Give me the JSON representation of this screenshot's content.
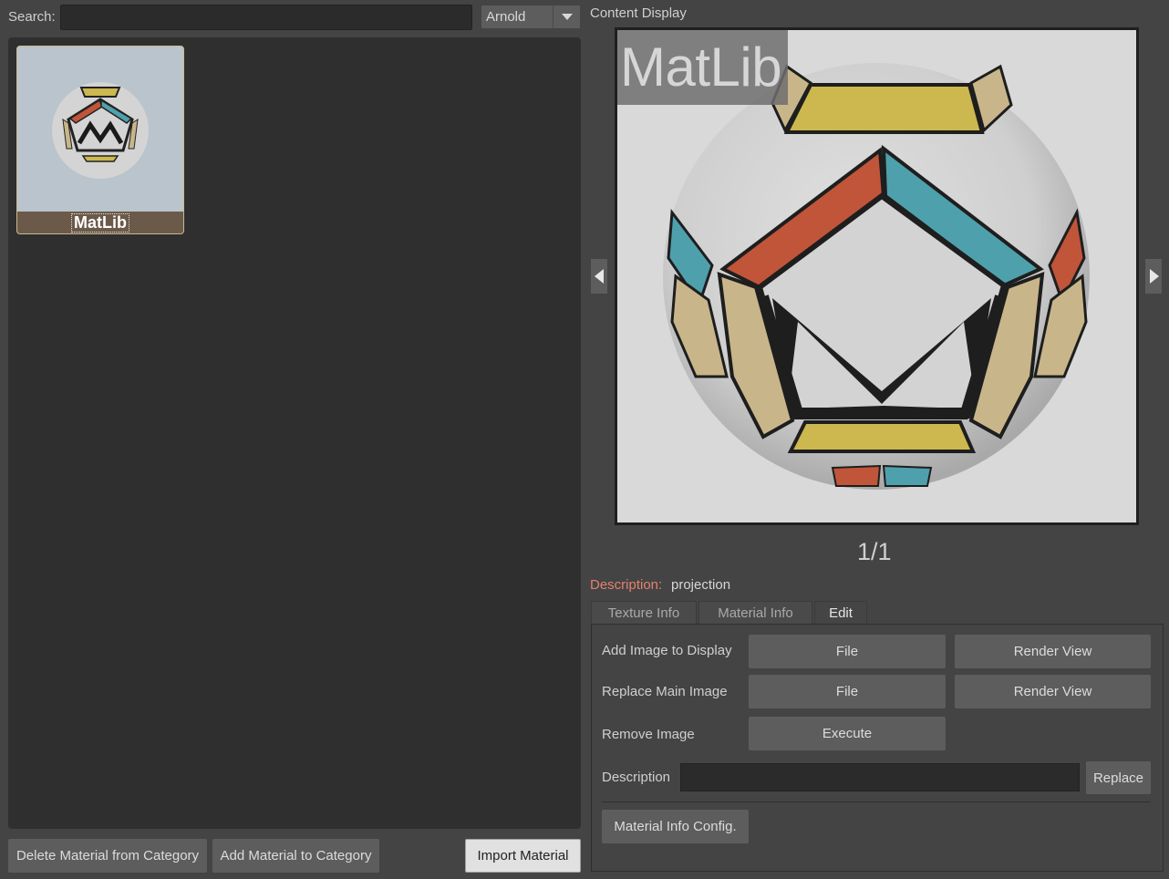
{
  "search": {
    "label": "Search:",
    "value": "",
    "placeholder": ""
  },
  "renderer": {
    "selected": "Arnold"
  },
  "materials": [
    {
      "name": "MatLib",
      "selected": true
    }
  ],
  "bottom_buttons": {
    "delete": "Delete Material from Category",
    "add": "Add Material to Category",
    "import": "Import Material"
  },
  "content_display": {
    "label": "Content Display",
    "overlay_title": "MatLib",
    "page": "1/1",
    "description_key": "Description:",
    "description_value": "projection"
  },
  "tabs": [
    {
      "label": "Texture Info",
      "active": false
    },
    {
      "label": "Material Info",
      "active": false
    },
    {
      "label": "Edit",
      "active": true
    }
  ],
  "edit": {
    "add_image_label": "Add Image to Display",
    "replace_main_label": "Replace Main Image",
    "remove_label": "Remove Image",
    "description_label": "Description",
    "file_label": "File",
    "render_view_label": "Render View",
    "execute_label": "Execute",
    "replace_label": "Replace",
    "config_label": "Material Info Config.",
    "description_value": ""
  },
  "colors": {
    "background": "#444444",
    "panel": "#2f2f2f",
    "description_key": "#e5806f",
    "tile_border": "#c9b98e"
  }
}
